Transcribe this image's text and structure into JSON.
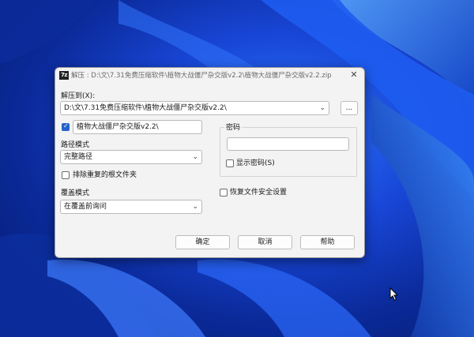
{
  "dialog": {
    "title": "解压 : D:\\文\\7.31免费压缩软件\\植物大战僵尸杂交版v2.2\\植物大战僵尸杂交版v2.2.zip",
    "app_icon_text": "7z",
    "close_symbol": "✕"
  },
  "extract_to": {
    "label": "解压到(X):",
    "path": "D:\\文\\7.31免费压缩软件\\植物大战僵尸杂交版v2.2\\",
    "browse_label": "...",
    "subfolder_checked": true,
    "subfolder_name": "植物大战僵尸杂交版v2.2\\"
  },
  "path_mode": {
    "label": "路径模式",
    "value": "完整路径"
  },
  "eliminate_duplicates": {
    "label": "排除重复的根文件夹",
    "checked": false
  },
  "overwrite_mode": {
    "label": "覆盖模式",
    "value": "在覆盖前询问"
  },
  "password": {
    "group_label": "密码",
    "value": "",
    "show_label": "显示密码(S)",
    "show_checked": false
  },
  "restore_security": {
    "label": "恢复文件安全设置",
    "checked": false
  },
  "buttons": {
    "ok": "确定",
    "cancel": "取消",
    "help": "帮助"
  },
  "dropdown_arrow": "⌄"
}
